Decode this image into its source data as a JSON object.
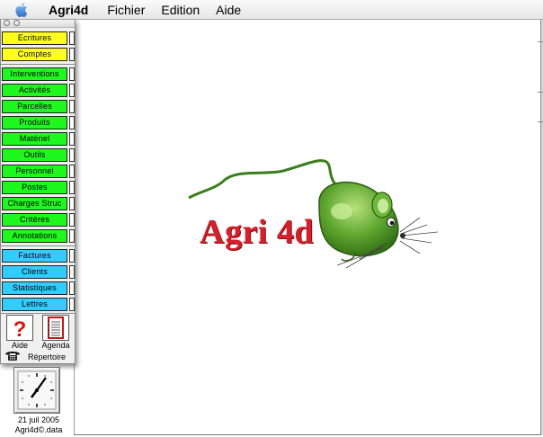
{
  "menubar": {
    "apple_icon": "apple-logo",
    "app_name": "Agri4d",
    "items": [
      "Fichier",
      "Edition",
      "Aide"
    ]
  },
  "palette": {
    "groups": [
      [
        "Ecritures",
        "Comptes"
      ],
      [
        "Interventions",
        "Activités",
        "Parcelles",
        "Produits",
        "Matériel",
        "Outils",
        "Personnel",
        "Postes",
        "Charges Struc",
        "Critères",
        "Annotations"
      ],
      [
        "Factures",
        "Clients",
        "Statistiques",
        "Lettres"
      ]
    ],
    "colors": {
      "yellow": "#ffff1e",
      "green": "#1ef81e",
      "blue": "#33ccff"
    },
    "tools": {
      "aide": "Aide",
      "agenda": "Agenda",
      "repertoire": "Répertoire"
    }
  },
  "logo": {
    "text": "Agri 4d"
  },
  "desktop": {
    "date": "21 juil 2005",
    "data_file": "Agri4d©.data"
  }
}
